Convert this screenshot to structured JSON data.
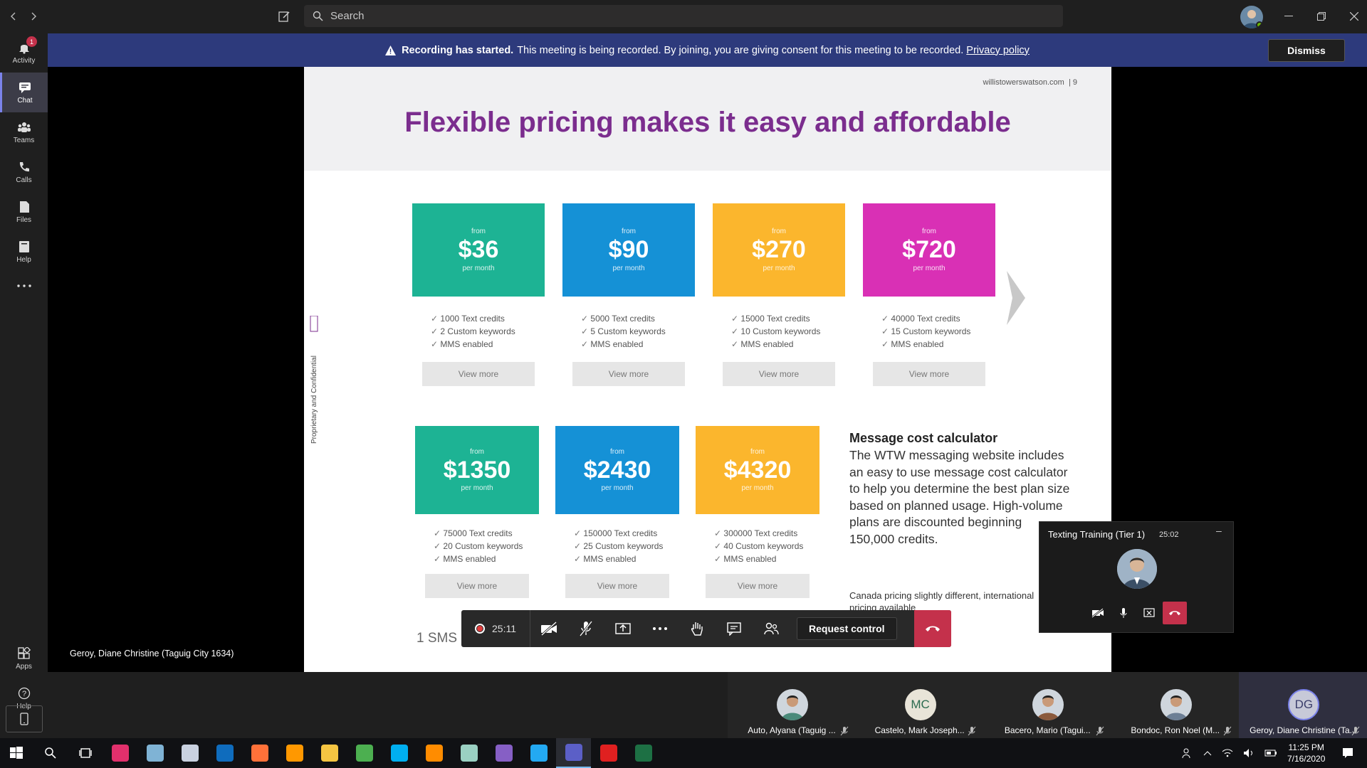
{
  "titlebar": {
    "search_placeholder": "Search",
    "icons": [
      "back-arrow-icon",
      "forward-arrow-icon",
      "compose-icon",
      "search-icon",
      "minimize-icon",
      "restore-icon",
      "close-icon"
    ]
  },
  "banner": {
    "title": "Recording has started.",
    "message": "This meeting is being recorded. By joining, you are giving consent for this meeting to be recorded.",
    "link": "Privacy policy",
    "dismiss": "Dismiss"
  },
  "rail": {
    "items": [
      {
        "label": "Activity",
        "badge": "1"
      },
      {
        "label": "Chat"
      },
      {
        "label": "Teams"
      },
      {
        "label": "Calls"
      },
      {
        "label": "Files"
      },
      {
        "label": "Help"
      }
    ],
    "bottom": [
      {
        "label": "Apps"
      },
      {
        "label": "Help"
      }
    ],
    "active": "Chat"
  },
  "slide": {
    "site": "willistowerswatson.com",
    "page": "9",
    "title": "Flexible pricing makes it easy and affordable",
    "side_label": "Proprietary and Confidential",
    "from_label": "from",
    "per_month": "per month",
    "view_more": "View more",
    "plans_row1": [
      {
        "price": "$36",
        "color": "#1db394",
        "features": [
          "1000 Text credits",
          "2 Custom keywords",
          "MMS enabled"
        ]
      },
      {
        "price": "$90",
        "color": "#1591d6",
        "features": [
          "5000 Text credits",
          "5 Custom keywords",
          "MMS enabled"
        ]
      },
      {
        "price": "$270",
        "color": "#fbb62d",
        "features": [
          "15000 Text credits",
          "10 Custom keywords",
          "MMS enabled"
        ]
      },
      {
        "price": "$720",
        "color": "#d930b5",
        "features": [
          "40000 Text credits",
          "15 Custom keywords",
          "MMS enabled"
        ]
      }
    ],
    "plans_row2": [
      {
        "price": "$1350",
        "color": "#1db394",
        "features": [
          "75000 Text credits",
          "20 Custom keywords",
          "MMS enabled"
        ]
      },
      {
        "price": "$2430",
        "color": "#1591d6",
        "features": [
          "150000 Text credits",
          "25 Custom keywords",
          "MMS enabled"
        ]
      },
      {
        "price": "$4320",
        "color": "#fbb62d",
        "features": [
          "300000 Text credits",
          "40 Custom keywords",
          "MMS enabled"
        ]
      }
    ],
    "calc_title": "Message cost calculator",
    "calc_body": "The WTW messaging website includes an easy to use message cost calculator to help you determine the best plan size based on planned usage. High-volume plans are discounted beginning 150,000 credits.",
    "calc_note": "Canada pricing slightly different, international pricing available",
    "footline": "1 SMS message"
  },
  "presenter_name": "Geroy, Diane Christine (Taguig City 1634)",
  "callbar": {
    "timer": "25:11",
    "request_control": "Request control"
  },
  "mini": {
    "title": "Texting Training (Tier 1)",
    "time": "25:02"
  },
  "participants": [
    {
      "name": "Auto, Alyana (Taguig ...",
      "type": "photo",
      "color": "#4a8a7a"
    },
    {
      "name": "Castelo, Mark Joseph...",
      "type": "initials",
      "initials": "MC"
    },
    {
      "name": "Bacero, Mario (Tagui...",
      "type": "photo",
      "color": "#8b5a3c"
    },
    {
      "name": "Bondoc, Ron Noel (M...",
      "type": "photo",
      "color": "#6d7f95"
    },
    {
      "name": "Geroy, Diane Christine (Ta...",
      "type": "initials",
      "initials": "DG",
      "self": true
    }
  ],
  "taskbar": {
    "time": "11:25 PM",
    "date": "7/16/2020",
    "apps": [
      {
        "name": "cortana-search-icon",
        "color": "#ffffff"
      },
      {
        "name": "task-view-icon",
        "color": "#ffffff"
      },
      {
        "name": "instagram-app-icon",
        "color": "#e1306c"
      },
      {
        "name": "paint-app-icon",
        "color": "#7fb3d5"
      },
      {
        "name": "paint-3d-app-icon",
        "color": "#c9d1e0"
      },
      {
        "name": "outlook-app-icon",
        "color": "#0f6cbd"
      },
      {
        "name": "firefox-app-icon",
        "color": "#ff7139"
      },
      {
        "name": "sublime-text-app-icon",
        "color": "#ff9800"
      },
      {
        "name": "file-explorer-app-icon",
        "color": "#f5c542"
      },
      {
        "name": "chrome-app-icon",
        "color": "#4caf50"
      },
      {
        "name": "skype-app-icon",
        "color": "#00aff0"
      },
      {
        "name": "search-tool-app-icon",
        "color": "#ff8c00"
      },
      {
        "name": "notes-app-icon",
        "color": "#9ad0c2"
      },
      {
        "name": "visual-studio-app-icon",
        "color": "#865fc5"
      },
      {
        "name": "vscode-app-icon",
        "color": "#23a9f2"
      },
      {
        "name": "teams-app-icon",
        "color": "#5b5fc7"
      },
      {
        "name": "acrobat-app-icon",
        "color": "#e02020"
      },
      {
        "name": "excel-app-icon",
        "color": "#1d7044"
      }
    ],
    "active_app": "teams-app-icon"
  }
}
